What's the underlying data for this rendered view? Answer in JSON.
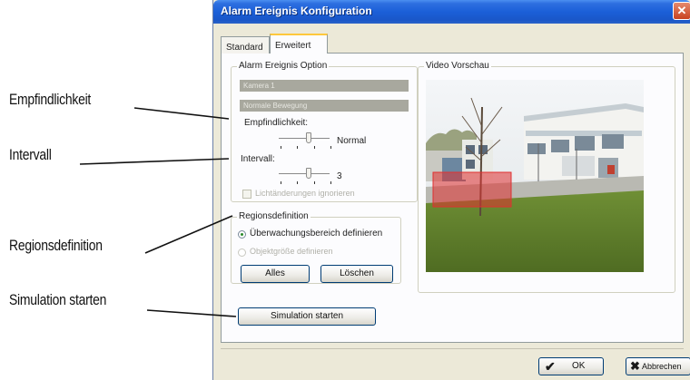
{
  "window": {
    "title": "Alarm Ereignis Konfiguration",
    "close_glyph": "✕"
  },
  "tabs": [
    {
      "label": "Standard",
      "active": false
    },
    {
      "label": "Erweitert",
      "active": true
    }
  ],
  "alarm_option": {
    "group_label": "Alarm Ereignis Option",
    "camera_value": "Kamera 1",
    "detection_value": "Normale Bewegung",
    "sensitivity_label": "Empfindlichkeit:",
    "sensitivity_value": "Normal",
    "sensitivity_level": 0.6,
    "interval_label": "Intervall:",
    "interval_value": "3",
    "interval_level": 0.6,
    "ignore_light_label": "Lichtänderungen ignorieren",
    "ignore_light_checked": false
  },
  "region": {
    "group_label": "Regionsdefinition",
    "radio_monitoring": "Überwachungsbereich definieren",
    "radio_object_size": "Objektgröße definieren",
    "all_button": "Alles",
    "delete_button": "Löschen"
  },
  "preview": {
    "group_label": "Video Vorschau"
  },
  "simulation_button": "Simulation starten",
  "footer": {
    "ok_label": "OK",
    "cancel_label": "Abbrechen",
    "ok_icon": "checkmark-icon",
    "cancel_icon": "x-icon"
  },
  "callouts": [
    {
      "id": "empfindlichkeit",
      "label": "Empfindlichkeit"
    },
    {
      "id": "intervall",
      "label": "Intervall"
    },
    {
      "id": "regionsdefinition",
      "label": "Regionsdefinition"
    },
    {
      "id": "simulation",
      "label": "Simulation starten"
    }
  ],
  "colors": {
    "title_bar": "#1b5fd8",
    "dialog_bg": "#ece9d8",
    "region_overlay": "#e03030",
    "button_border": "#003c74"
  }
}
